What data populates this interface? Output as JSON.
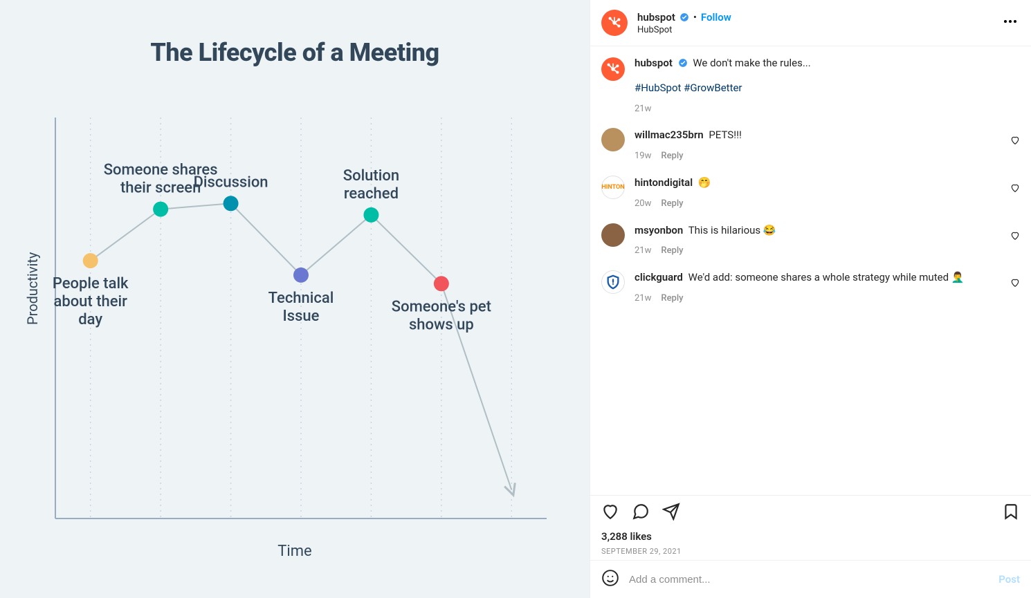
{
  "header": {
    "username": "hubspot",
    "subname": "HubSpot",
    "follow_label": "Follow",
    "dot": "•"
  },
  "caption": {
    "username": "hubspot",
    "text": "We don't make the rules...",
    "hashtags": "#HubSpot #GrowBetter",
    "age": "21w"
  },
  "comments": [
    {
      "username": "willmac235brn",
      "text": "PETS!!!",
      "age": "19w",
      "reply": "Reply",
      "avatar_bg": "#b8915f"
    },
    {
      "username": "hintondigital",
      "text": "🤭",
      "age": "20w",
      "reply": "Reply",
      "avatar_bg": "#ffffff",
      "avatar_border": "#e0e0e0",
      "avatar_label": "HINTON"
    },
    {
      "username": "msyonbon",
      "text": "This is hilarious 😂",
      "age": "21w",
      "reply": "Reply",
      "avatar_bg": "#8a6244"
    },
    {
      "username": "clickguard",
      "text": "We'd add: someone shares a whole strategy while muted 🤦‍♂️",
      "age": "21w",
      "reply": "Reply",
      "avatar_bg": "#ffffff",
      "avatar_border": "#e0e0e0",
      "avatar_shield": true
    }
  ],
  "footer": {
    "likes": "3,288 likes",
    "date": "SEPTEMBER 29, 2021",
    "comment_placeholder": "Add a comment...",
    "post_label": "Post"
  },
  "chart_data": {
    "type": "line",
    "title": "The Lifecycle of a Meeting",
    "xlabel": "Time",
    "ylabel": "Productivity",
    "x": [
      1,
      2,
      3,
      4,
      5,
      6,
      7
    ],
    "y": [
      50,
      68,
      70,
      45,
      66,
      42,
      -30
    ],
    "ylim": [
      -40,
      100
    ],
    "points": [
      {
        "x": 1,
        "y": 50,
        "label": "People talk about their day",
        "label_pos": "below",
        "color": "#f5c26b"
      },
      {
        "x": 2,
        "y": 68,
        "label": "Someone shares their screen",
        "label_pos": "above",
        "color": "#00bda5"
      },
      {
        "x": 3,
        "y": 70,
        "label": "Discussion",
        "label_pos": "above",
        "color": "#0091ae"
      },
      {
        "x": 4,
        "y": 45,
        "label": "Technical Issue",
        "label_pos": "below",
        "color": "#6a78d1"
      },
      {
        "x": 5,
        "y": 66,
        "label": "Solution reached",
        "label_pos": "above",
        "color": "#00bda5"
      },
      {
        "x": 6,
        "y": 42,
        "label": "Someone's pet shows up",
        "label_pos": "below",
        "color": "#f2545b"
      }
    ],
    "arrow_end": {
      "x": 7,
      "y": -30
    }
  }
}
